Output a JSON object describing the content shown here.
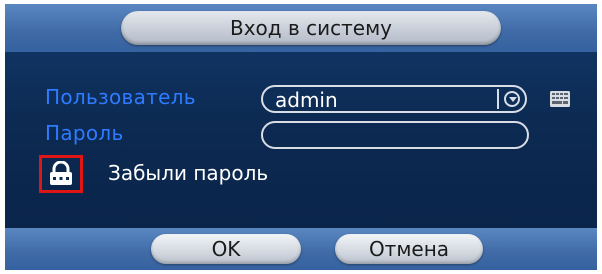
{
  "dialog": {
    "title": "Вход в систему"
  },
  "form": {
    "user_label": "Пользователь",
    "user_value": "admin",
    "password_label": "Пароль",
    "password_value": "",
    "forgot_label": "Забыли пароль"
  },
  "icons": {
    "dropdown": "chevron-down-icon",
    "keyboard": "keyboard-icon",
    "forgot": "lock-icon"
  },
  "buttons": {
    "ok_label": "OK",
    "cancel_label": "Отмена"
  },
  "colors": {
    "label_blue": "#2e7bff",
    "highlight_red": "#e01515"
  }
}
